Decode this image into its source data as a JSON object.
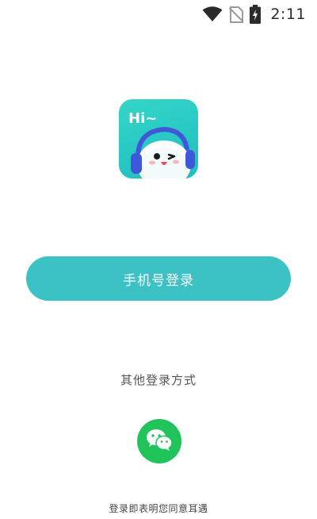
{
  "status_bar": {
    "time": "2:11",
    "icons": [
      "wifi-icon",
      "no-sim-icon",
      "battery-charging-icon"
    ]
  },
  "app": {
    "icon_text": "Hi~",
    "icon_name": "mascot-headphones-app-icon"
  },
  "login": {
    "phone_button_label": "手机号登录",
    "other_methods_title": "其他登录方式",
    "wechat_icon": "wechat-icon",
    "agreement_text": "登录即表明您同意耳遇"
  },
  "colors": {
    "accent": "#3cc1c4",
    "wechat_green": "#20c45a",
    "icon_bg": "#27c7c4"
  }
}
